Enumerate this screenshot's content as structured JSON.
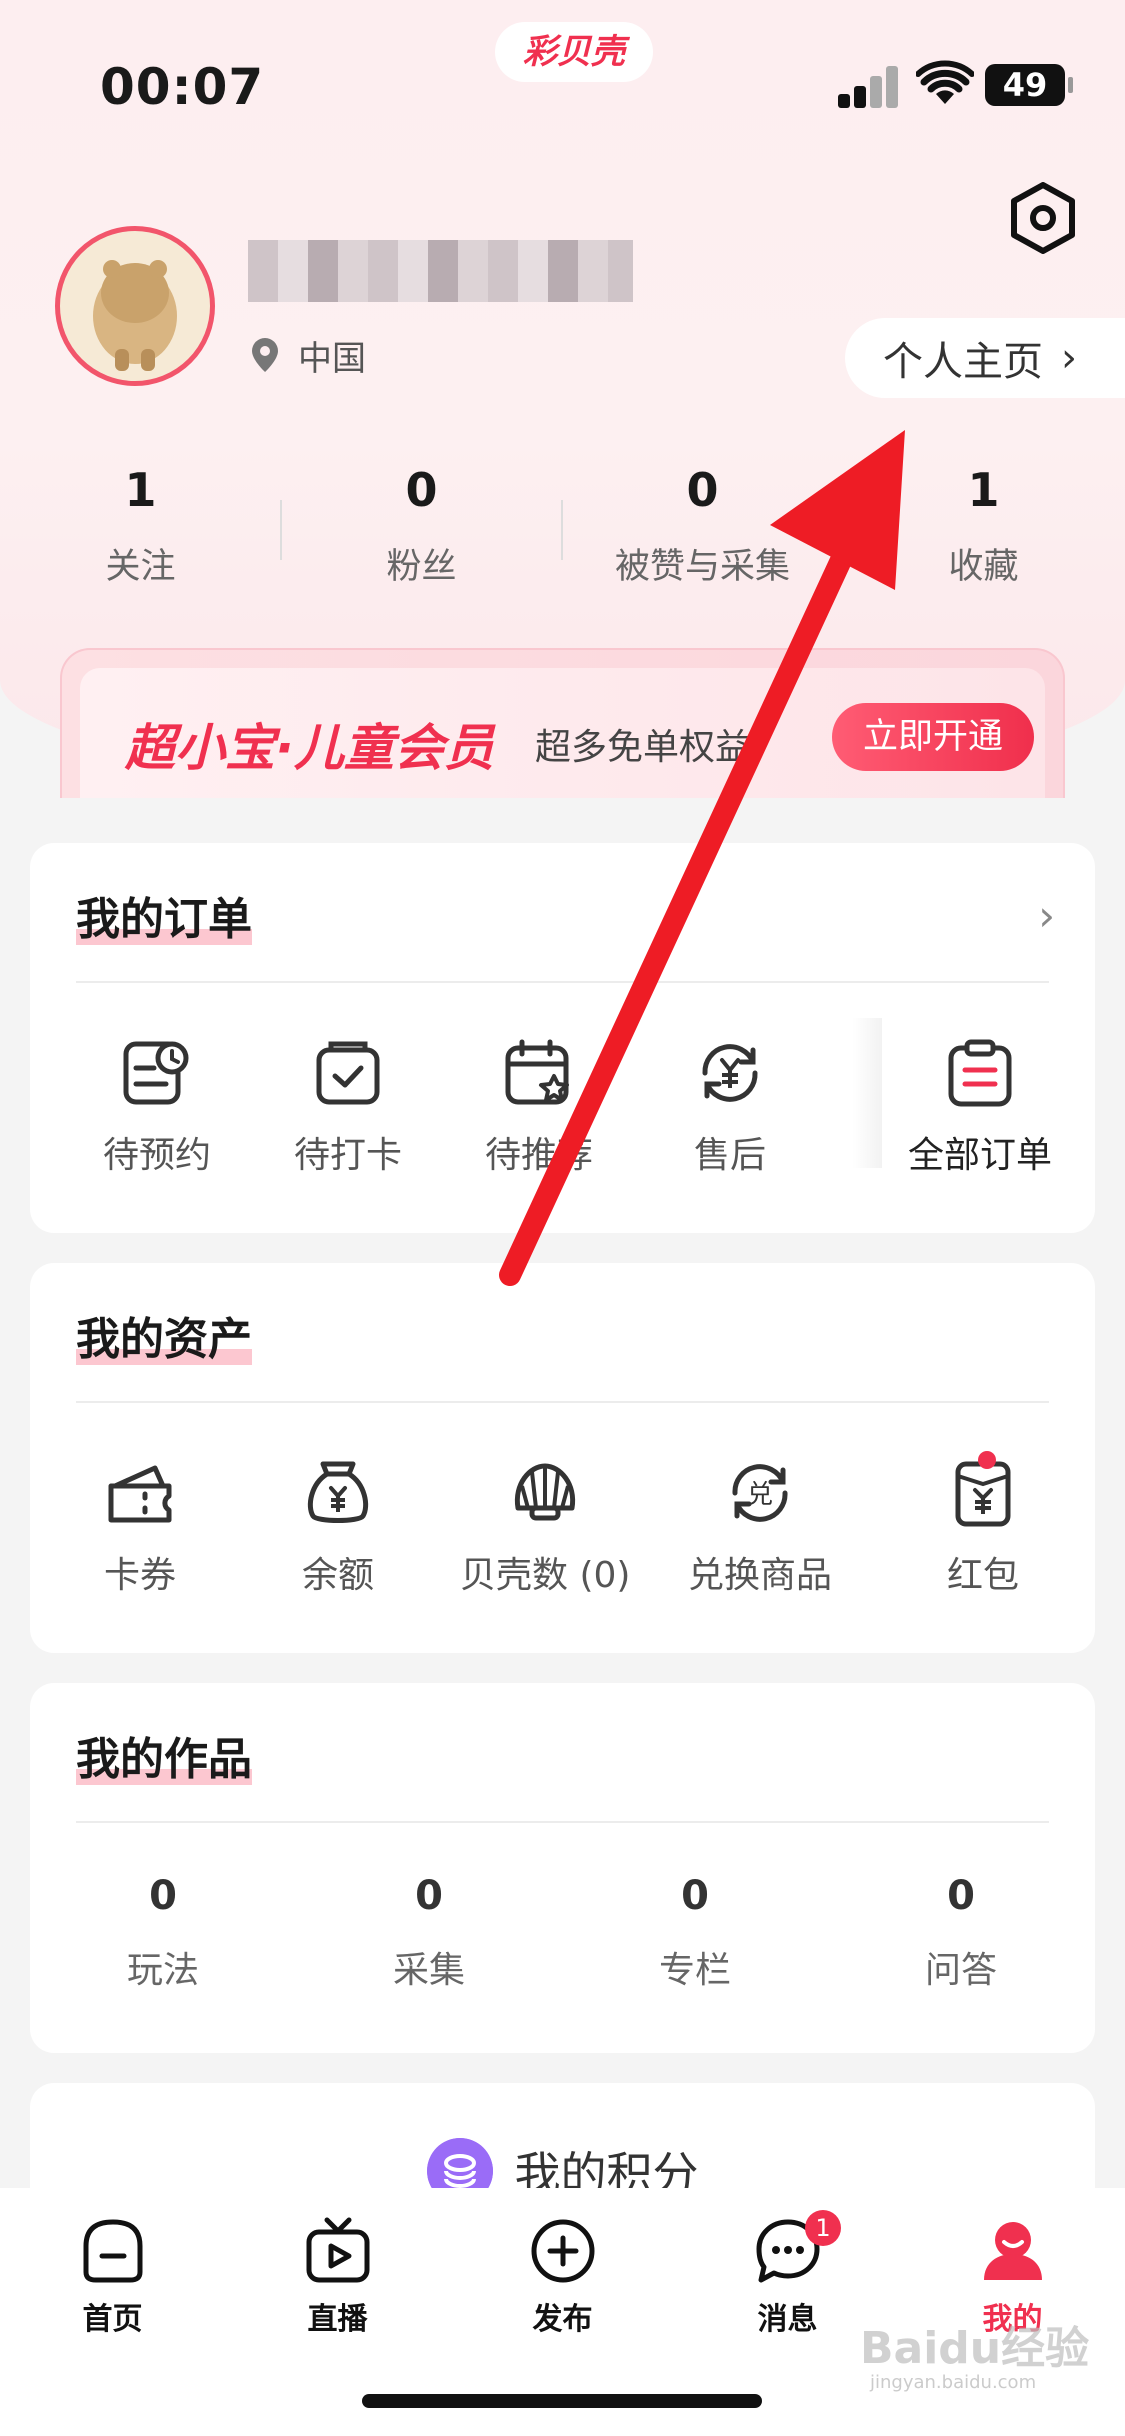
{
  "status_bar": {
    "time": "00:07",
    "app_name": "彩贝壳",
    "battery": "49"
  },
  "profile": {
    "location": "中国",
    "homepage_label": "个人主页",
    "stats": [
      {
        "value": "1",
        "label": "关注"
      },
      {
        "value": "0",
        "label": "粉丝"
      },
      {
        "value": "0",
        "label": "被赞与采集"
      },
      {
        "value": "1",
        "label": "收藏"
      }
    ]
  },
  "member_banner": {
    "title": "超小宝·儿童会员",
    "subtitle": "超多免单权益",
    "button": "立即开通"
  },
  "orders": {
    "title": "我的订单",
    "items": [
      {
        "label": "待预约",
        "icon": "clock-list-icon"
      },
      {
        "label": "待打卡",
        "icon": "check-card-icon"
      },
      {
        "label": "待推荐",
        "icon": "calendar-star-icon"
      },
      {
        "label": "售后",
        "icon": "yen-refresh-icon"
      },
      {
        "label": "全部订单",
        "icon": "clipboard-icon"
      }
    ]
  },
  "assets": {
    "title": "我的资产",
    "items": [
      {
        "label": "卡券",
        "icon": "ticket-icon"
      },
      {
        "label": "余额",
        "icon": "money-bag-icon"
      },
      {
        "label": "贝壳数 (0)",
        "icon": "shell-icon"
      },
      {
        "label": "兑换商品",
        "icon": "exchange-icon"
      },
      {
        "label": "红包",
        "icon": "red-envelope-icon"
      }
    ]
  },
  "works": {
    "title": "我的作品",
    "items": [
      {
        "value": "0",
        "label": "玩法"
      },
      {
        "value": "0",
        "label": "采集"
      },
      {
        "value": "0",
        "label": "专栏"
      },
      {
        "value": "0",
        "label": "问答"
      }
    ]
  },
  "points": {
    "label": "我的积分"
  },
  "bottom_nav": {
    "items": [
      {
        "label": "首页",
        "icon": "home-icon"
      },
      {
        "label": "直播",
        "icon": "live-tv-icon"
      },
      {
        "label": "发布",
        "icon": "plus-circle-icon"
      },
      {
        "label": "消息",
        "icon": "chat-icon",
        "badge": "1"
      },
      {
        "label": "我的",
        "icon": "user-icon"
      }
    ],
    "active_index": 4
  },
  "colors": {
    "accent": "#f0304f",
    "highlight": "#fcc7d0",
    "annotation_arrow": "#ee1c25"
  },
  "watermark": {
    "text": "Baidu经验",
    "sub": "jingyan.baidu.com"
  }
}
